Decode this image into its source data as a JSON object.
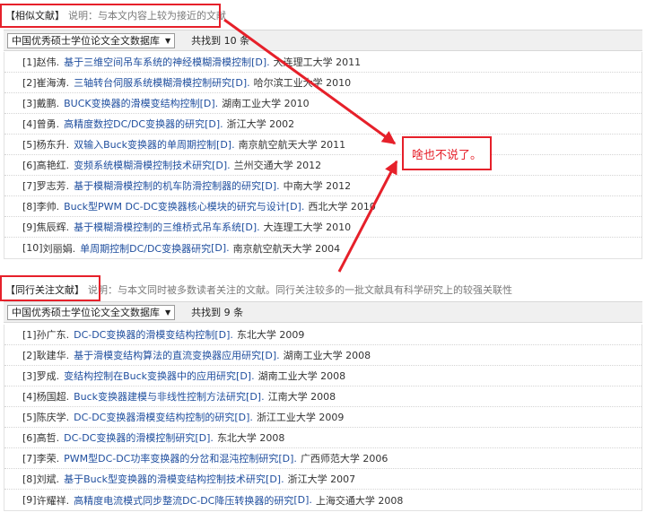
{
  "similar": {
    "title": "【相似文献】",
    "description": "说明：与本文内容上较为接近的文献",
    "database_select": "中国优秀硕士学位论文全文数据库",
    "count_text": "共找到 10 条",
    "items": [
      {
        "index": "[1]",
        "author": "赵伟.",
        "title": "基于三维空间吊车系统的神经模糊滑模控制",
        "type": "[D].",
        "source": "大连理工大学 2011"
      },
      {
        "index": "[2]",
        "author": "崔海涛.",
        "title": "三轴转台伺服系统模糊滑模控制研究",
        "type": "[D].",
        "source": "哈尔滨工业大学 2010"
      },
      {
        "index": "[3]",
        "author": "戴鹏.",
        "title": "BUCK变换器的滑模变结构控制",
        "type": "[D].",
        "source": "湖南工业大学 2010"
      },
      {
        "index": "[4]",
        "author": "曾勇.",
        "title": "高精度数控DC/DC变换器的研究",
        "type": "[D].",
        "source": "浙江大学 2002"
      },
      {
        "index": "[5]",
        "author": "杨东升.",
        "title": "双输入Buck变换器的单周期控制",
        "type": "[D].",
        "source": "南京航空航天大学 2011"
      },
      {
        "index": "[6]",
        "author": "高艳红.",
        "title": "变频系统模糊滑模控制技术研究",
        "type": "[D].",
        "source": "兰州交通大学 2012"
      },
      {
        "index": "[7]",
        "author": "罗志芳.",
        "title": "基于模糊滑模控制的机车防滑控制器的研究",
        "type": "[D].",
        "source": "中南大学 2012"
      },
      {
        "index": "[8]",
        "author": "李帅.",
        "title": "Buck型PWM DC-DC变换器核心模块的研究与设计",
        "type": "[D].",
        "source": "西北大学 2010"
      },
      {
        "index": "[9]",
        "author": "焦辰辉.",
        "title": "基于模糊滑模控制的三维桥式吊车系统",
        "type": "[D].",
        "source": "大连理工大学 2010"
      },
      {
        "index": "[10]",
        "author": "刘丽娟.",
        "title": "单周期控制DC/DC变换器研究",
        "type": "[D].",
        "source": "南京航空航天大学 2004"
      }
    ]
  },
  "callout": {
    "text": "啥也不说了。"
  },
  "peer": {
    "title": "【同行关注文献】",
    "description": "说明：与本文同时被多数读者关注的文献。同行关注较多的一批文献具有科学研究上的较强关联性",
    "database_select": "中国优秀硕士学位论文全文数据库",
    "count_text": "共找到 9 条",
    "items": [
      {
        "index": "[1]",
        "author": "孙广东.",
        "title": "DC-DC变换器的滑模变结构控制",
        "type": "[D].",
        "source": "东北大学 2009"
      },
      {
        "index": "[2]",
        "author": "耿建华.",
        "title": "基于滑模变结构算法的直流变换器应用研究",
        "type": "[D].",
        "source": "湖南工业大学 2008"
      },
      {
        "index": "[3]",
        "author": "罗成.",
        "title": "变结构控制在Buck变换器中的应用研究",
        "type": "[D].",
        "source": "湖南工业大学 2008"
      },
      {
        "index": "[4]",
        "author": "杨国超.",
        "title": "Buck变换器建模与非线性控制方法研究",
        "type": "[D].",
        "source": "江南大学 2008"
      },
      {
        "index": "[5]",
        "author": "陈庆学.",
        "title": "DC-DC变换器滑模变结构控制的研究",
        "type": "[D].",
        "source": "浙江工业大学 2009"
      },
      {
        "index": "[6]",
        "author": "高哲.",
        "title": "DC-DC变换器的滑模控制研究",
        "type": "[D].",
        "source": "东北大学 2008"
      },
      {
        "index": "[7]",
        "author": "李荣.",
        "title": "PWM型DC-DC功率变换器的分岔和混沌控制研究",
        "type": "[D].",
        "source": "广西师范大学 2006"
      },
      {
        "index": "[8]",
        "author": "刘斌.",
        "title": "基于Buck型变换器的滑模变结构控制技术研究",
        "type": "[D].",
        "source": "浙江大学 2007"
      },
      {
        "index": "[9]",
        "author": "许耀祥.",
        "title": "高精度电流模式同步整流DC-DC降压转换器的研究",
        "type": "[D].",
        "source": "上海交通大学 2008"
      }
    ]
  },
  "colors": {
    "annotation_red": "#e6202a",
    "link_blue": "#1f4e9e"
  }
}
